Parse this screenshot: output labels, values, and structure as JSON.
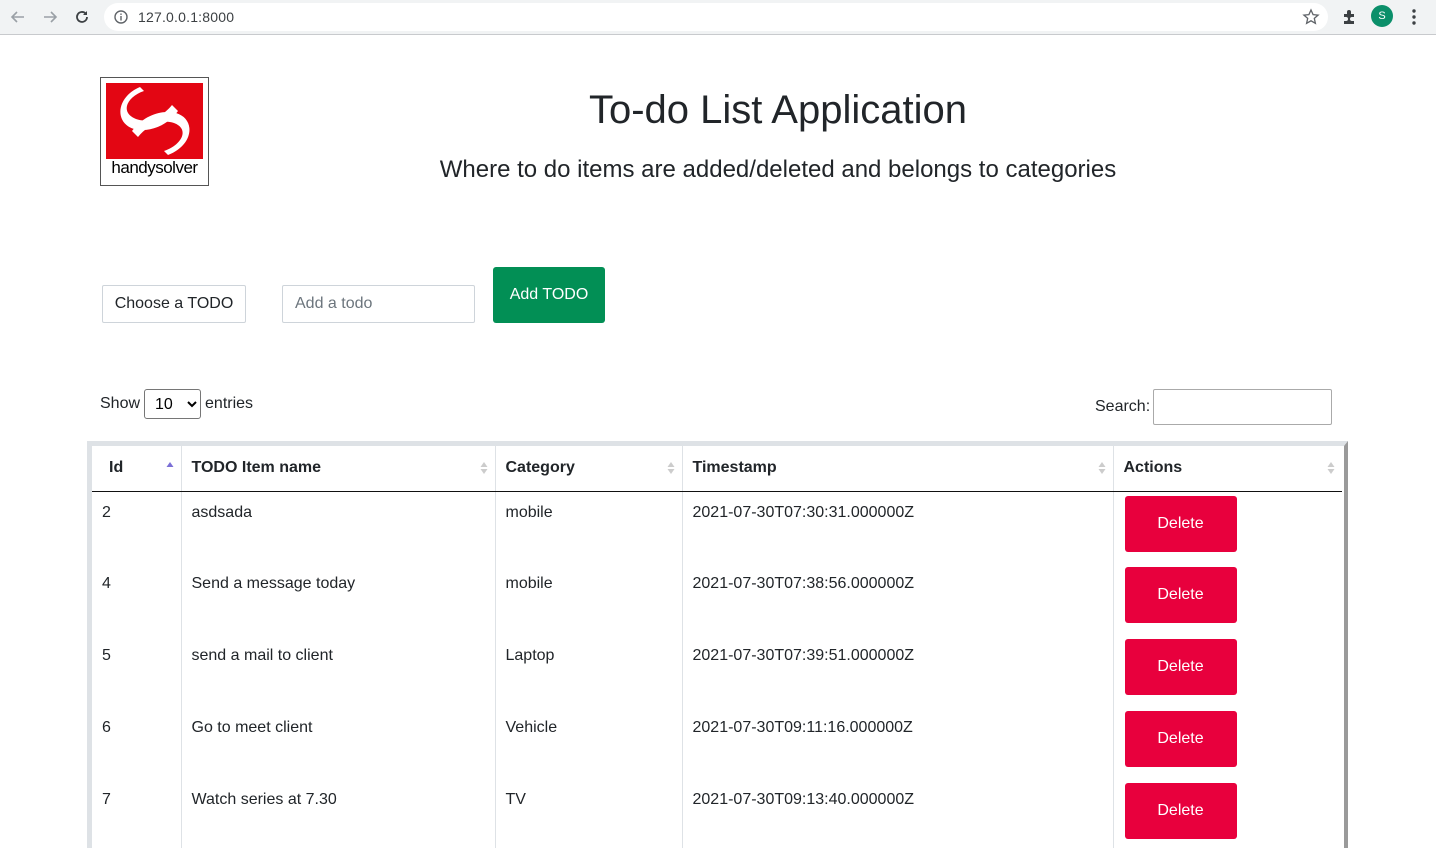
{
  "browser": {
    "url": "127.0.0.1:8000",
    "profile_initial": "S"
  },
  "logo": {
    "text": "handysolver"
  },
  "header": {
    "title": "To-do List Application",
    "subtitle": "Where to do items are added/deleted and belongs to categories"
  },
  "form": {
    "choose_label": "Choose a TODO",
    "input_placeholder": "Add a todo",
    "add_label": "Add TODO"
  },
  "table_controls": {
    "show_label": "Show",
    "entries_value": "10",
    "entries_label": "entries",
    "search_label": "Search:"
  },
  "table": {
    "columns": [
      "Id",
      "TODO Item name",
      "Category",
      "Timestamp",
      "Actions"
    ],
    "rows": [
      {
        "id": "2",
        "name": "asdsada",
        "category": "mobile",
        "timestamp": "2021-07-30T07:30:31.000000Z",
        "action": "Delete"
      },
      {
        "id": "4",
        "name": "Send a message today",
        "category": "mobile",
        "timestamp": "2021-07-30T07:38:56.000000Z",
        "action": "Delete"
      },
      {
        "id": "5",
        "name": "send a mail to client",
        "category": "Laptop",
        "timestamp": "2021-07-30T07:39:51.000000Z",
        "action": "Delete"
      },
      {
        "id": "6",
        "name": "Go to meet client",
        "category": "Vehicle",
        "timestamp": "2021-07-30T09:11:16.000000Z",
        "action": "Delete"
      },
      {
        "id": "7",
        "name": "Watch series at 7.30",
        "category": "TV",
        "timestamp": "2021-07-30T09:13:40.000000Z",
        "action": "Delete"
      }
    ]
  },
  "colors": {
    "add_button": "#028f55",
    "delete_button": "#e8003d",
    "logo_red": "#e30613",
    "sort_active": "#7b6fd6"
  },
  "icons": [
    "back-arrow-icon",
    "forward-arrow-icon",
    "reload-icon",
    "info-icon",
    "star-icon",
    "extensions-icon",
    "menu-dots-icon",
    "sort-icon"
  ]
}
